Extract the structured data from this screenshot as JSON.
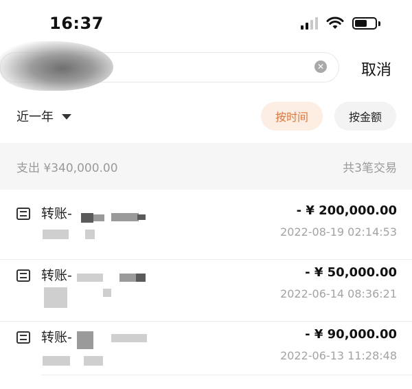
{
  "status_bar": {
    "time": "16:37"
  },
  "search": {
    "value": "",
    "cancel_label": "取消",
    "clear_icon": "clear-circle-icon"
  },
  "filter": {
    "range_label": "近一年",
    "sort_by_time": "按时间",
    "sort_by_amount": "按金额",
    "active_sort": "time",
    "accent_color": "#e2773a"
  },
  "summary": {
    "expense_label": "支出 ¥340,000.00",
    "count_label": "共3笔交易"
  },
  "transactions": [
    {
      "icon": "transfer-icon",
      "title": "转账-",
      "amount": "- ¥ 200,000.00",
      "time": "2022-08-19 02:14:53"
    },
    {
      "icon": "transfer-icon",
      "title": "转账-",
      "amount": "- ¥ 50,000.00",
      "time": "2022-06-14 08:36:21"
    },
    {
      "icon": "transfer-icon",
      "title": "转账-",
      "amount": "- ¥ 90,000.00",
      "time": "2022-06-13 11:28:48"
    }
  ]
}
